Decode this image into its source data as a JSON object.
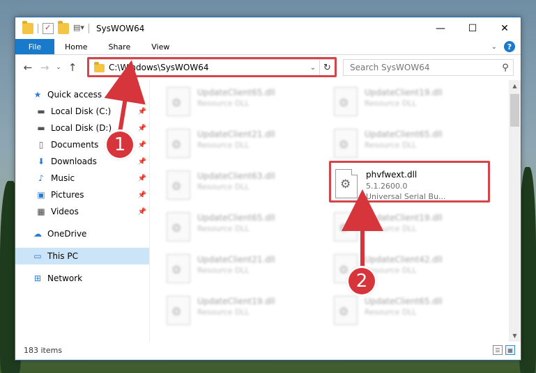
{
  "window": {
    "title": "SysWOW64",
    "minimize": "—",
    "maximize": "☐",
    "close": "✕"
  },
  "ribbon": {
    "tabs": [
      "File",
      "Home",
      "Share",
      "View"
    ],
    "help": "?"
  },
  "address": {
    "path": "C:\\Windows\\SysWOW64"
  },
  "search": {
    "placeholder": "Search SysWOW64"
  },
  "nav": {
    "quick_access": "Quick access",
    "quick_items": [
      {
        "label": "Local Disk (C:)",
        "icon": "drive-icon"
      },
      {
        "label": "Local Disk (D:)",
        "icon": "drive-icon"
      },
      {
        "label": "Documents",
        "icon": "documents-icon"
      },
      {
        "label": "Downloads",
        "icon": "downloads-icon"
      },
      {
        "label": "Music",
        "icon": "music-icon"
      },
      {
        "label": "Pictures",
        "icon": "pictures-icon"
      },
      {
        "label": "Videos",
        "icon": "videos-icon"
      }
    ],
    "onedrive": "OneDrive",
    "this_pc": "This PC",
    "network": "Network"
  },
  "files": [
    {
      "name": "UpdateClient65.dll",
      "type": "Resource DLL"
    },
    {
      "name": "UpdateClient19.dll",
      "type": "Resource DLL"
    },
    {
      "name": "UpdateClient21.dll",
      "type": "Resource DLL"
    },
    {
      "name": "UpdateClient65.dll",
      "type": "Resource DLL"
    },
    {
      "name": "UpdateClient63.dll",
      "type": "Resource DLL"
    },
    {
      "name": "UpdateClient65.dll",
      "type": "Resource DLL"
    },
    {
      "name": "UpdateClient19.dll",
      "type": "Resource DLL"
    },
    {
      "name": "UpdateClient21.dll",
      "type": "Resource DLL"
    },
    {
      "name": "UpdateClient42.dll",
      "type": "Resource DLL"
    },
    {
      "name": "UpdateClient19.dll",
      "type": "Resource DLL"
    },
    {
      "name": "UpdateClient65.dll",
      "type": "Resource DLL"
    }
  ],
  "target_file": {
    "name": "phvfwext.dll",
    "version": "5.1.2600.0",
    "description": "Universal Serial Bu..."
  },
  "status": {
    "count": "183 items"
  },
  "annotations": {
    "step1": "1",
    "step2": "2",
    "color": "#d6353b"
  }
}
